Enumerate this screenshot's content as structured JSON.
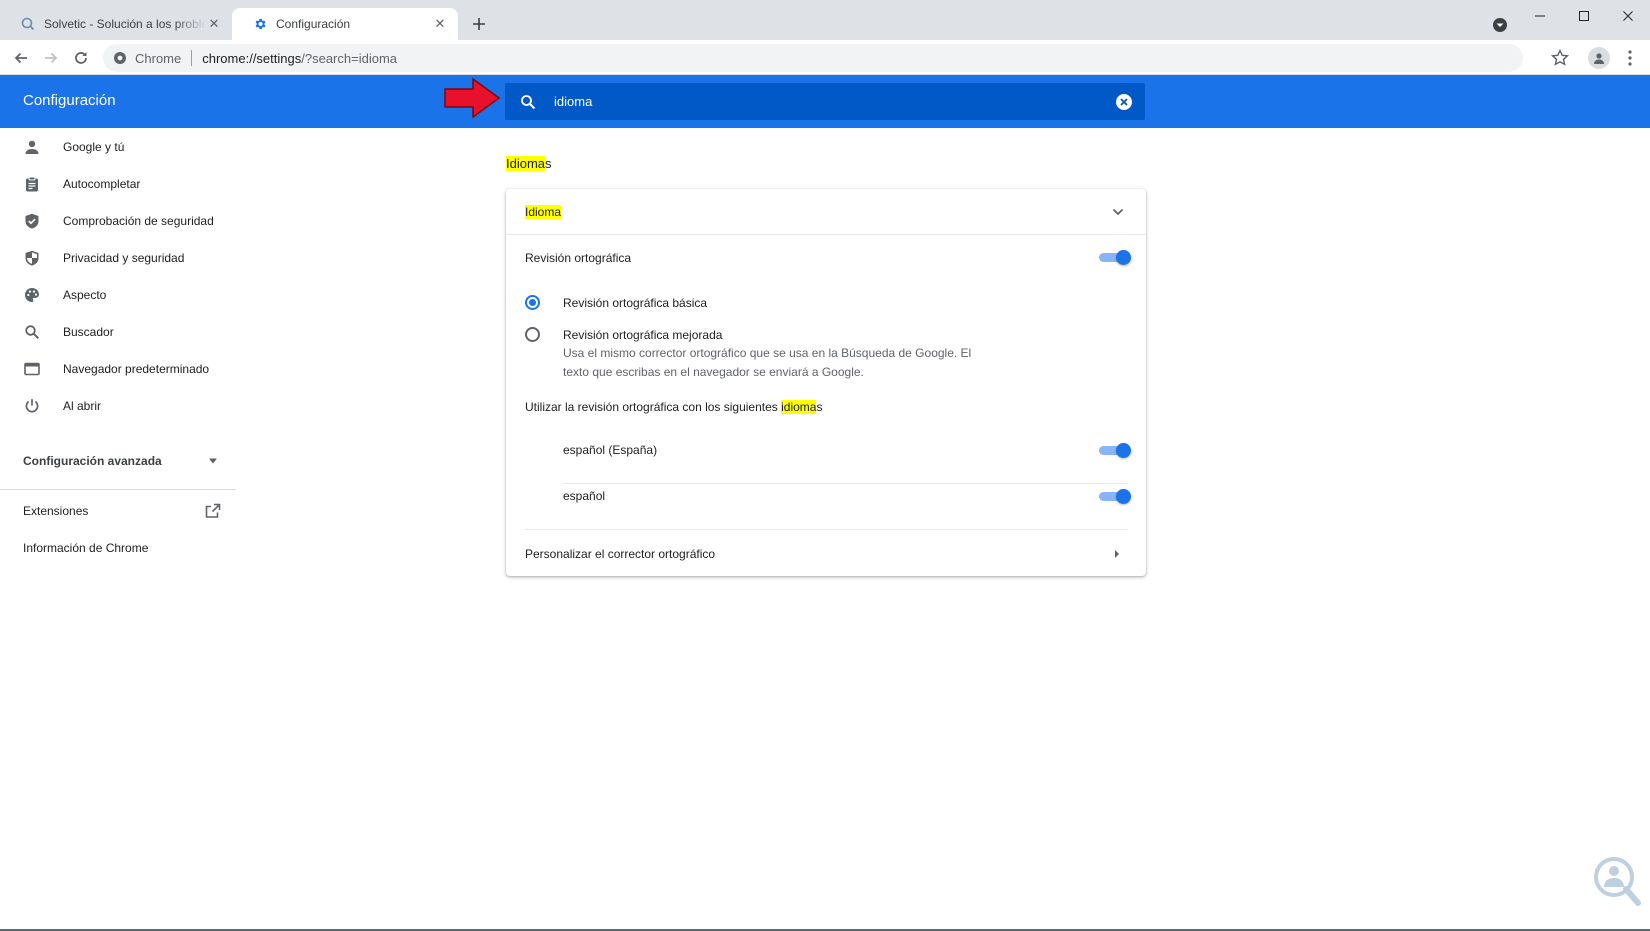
{
  "tabs": [
    {
      "title": "Solvetic - Solución a los problemas",
      "icon": "solvetic-favicon",
      "active": false
    },
    {
      "title": "Configuración",
      "icon": "settings-gear-icon",
      "active": true
    }
  ],
  "toolbar": {
    "site_chip": "Chrome",
    "url_host": "chrome://settings",
    "url_rest": "/?search=idioma"
  },
  "header": {
    "title": "Configuración",
    "search_value": "idioma"
  },
  "sidebar": {
    "items": [
      {
        "label": "Google y tú",
        "icon": "person-icon"
      },
      {
        "label": "Autocompletar",
        "icon": "clipboard-icon"
      },
      {
        "label": "Comprobación de seguridad",
        "icon": "shield-check-icon"
      },
      {
        "label": "Privacidad y seguridad",
        "icon": "shield-icon"
      },
      {
        "label": "Aspecto",
        "icon": "palette-icon"
      },
      {
        "label": "Buscador",
        "icon": "search-icon"
      },
      {
        "label": "Navegador predeterminado",
        "icon": "browser-window-icon"
      },
      {
        "label": "Al abrir",
        "icon": "power-icon"
      }
    ],
    "advanced": "Configuración avanzada",
    "extensions": "Extensiones",
    "about": "Información de Chrome"
  },
  "main": {
    "section_title_highlight": "Idioma",
    "section_title_rest": "s",
    "language_row_highlight": "Idioma",
    "spellcheck_label": "Revisión ortográfica",
    "spellcheck_enabled": true,
    "radio_basic": "Revisión ortográfica básica",
    "radio_enhanced": "Revisión ortográfica mejorada",
    "radio_enhanced_desc_1": "Usa el mismo corrector ortográfico que se usa en la Búsqueda de Google. El",
    "radio_enhanced_desc_2": "texto que escribas en el navegador se enviará a Google.",
    "selected_radio": "basic",
    "use_spellcheck_prefix": "Utilizar la revisión ortográfica con los siguientes ",
    "use_spellcheck_highlight": "idioma",
    "use_spellcheck_suffix": "s",
    "languages": [
      {
        "name": "español (España)",
        "enabled": true
      },
      {
        "name": "español",
        "enabled": true
      }
    ],
    "customize": "Personalizar el corrector ortográfico"
  },
  "colors": {
    "accent": "#1a73e8",
    "header_bg": "#1a73e8",
    "search_bg": "#0059c7",
    "highlight": "#ffff00",
    "arrow": "#e8102a"
  }
}
